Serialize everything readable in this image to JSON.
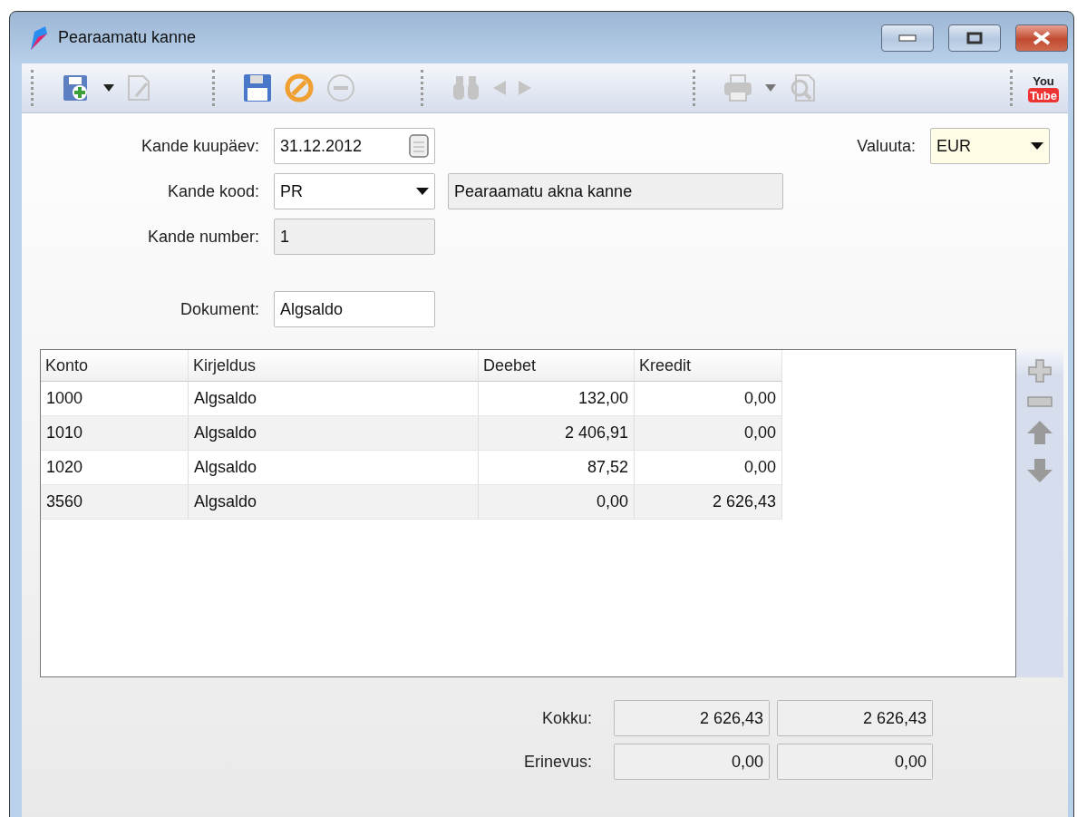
{
  "window": {
    "title": "Pearaamatu kanne"
  },
  "toolbar": [
    [
      {
        "kind": "new",
        "disabled": false
      },
      {
        "kind": "dropdown",
        "disabled": false
      },
      {
        "kind": "edit",
        "disabled": true
      }
    ],
    [
      {
        "kind": "save",
        "disabled": false
      },
      {
        "kind": "cancel",
        "disabled": false
      },
      {
        "kind": "remove",
        "disabled": true
      }
    ],
    [
      {
        "kind": "find",
        "disabled": true
      },
      {
        "kind": "prev",
        "disabled": true
      },
      {
        "kind": "next",
        "disabled": true
      }
    ],
    [
      {
        "kind": "print",
        "disabled": true
      },
      {
        "kind": "dropdown",
        "disabled": true
      },
      {
        "kind": "preview",
        "disabled": true
      }
    ]
  ],
  "youtube_logo": {
    "top": "You",
    "bottom": "Tube"
  },
  "form": {
    "date_label": "Kande kuupäev:",
    "date": "31.12.2012",
    "code_label": "Kande kood:",
    "code": "PR",
    "code_description": "Pearaamatu akna kanne",
    "number_label": "Kande number:",
    "number": "1",
    "document_label": "Dokument:",
    "document": "Algsaldo",
    "currency_label": "Valuuta:",
    "currency": "EUR"
  },
  "table": {
    "columns": [
      "Konto",
      "Kirjeldus",
      "Deebet",
      "Kreedit"
    ],
    "rows": [
      [
        "1000",
        "Algsaldo",
        "132,00",
        "0,00"
      ],
      [
        "1010",
        "Algsaldo",
        "2 406,91",
        "0,00"
      ],
      [
        "1020",
        "Algsaldo",
        "87,52",
        "0,00"
      ],
      [
        "3560",
        "Algsaldo",
        "0,00",
        "2 626,43"
      ]
    ]
  },
  "row_tools": [
    {
      "kind": "add",
      "disabled": true
    },
    {
      "kind": "delete",
      "disabled": true
    },
    {
      "kind": "up",
      "disabled": true
    },
    {
      "kind": "down",
      "disabled": true
    }
  ],
  "totals": {
    "total_label": "Kokku:",
    "total_debit": "2 626,43",
    "total_credit": "2 626,43",
    "difference_label": "Erinevus:",
    "difference_debit": "0,00",
    "difference_credit": "0,00"
  }
}
